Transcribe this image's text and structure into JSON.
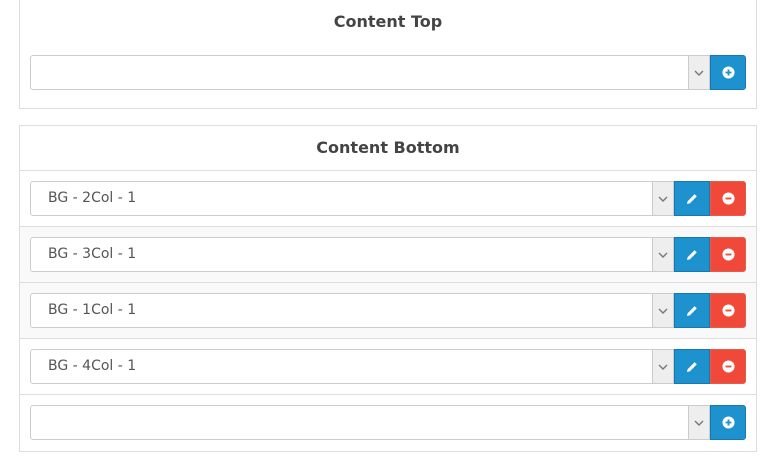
{
  "content_top": {
    "title": "Content Top",
    "empty_select_value": ""
  },
  "content_bottom": {
    "title": "Content Bottom",
    "modules": [
      {
        "label": "BG - 2Col - 1"
      },
      {
        "label": "BG - 3Col - 1"
      },
      {
        "label": "BG - 1Col - 1"
      },
      {
        "label": "BG - 4Col - 1"
      }
    ],
    "empty_select_value": ""
  },
  "icons": {
    "dropdown": "chevron-down-icon",
    "add": "plus-circle-icon",
    "edit": "pencil-icon",
    "remove": "minus-circle-icon"
  },
  "colors": {
    "primary_button": "#1e91cf",
    "danger_button": "#f0493a",
    "border": "#dddddd",
    "stripe": "#f9f9f9"
  }
}
